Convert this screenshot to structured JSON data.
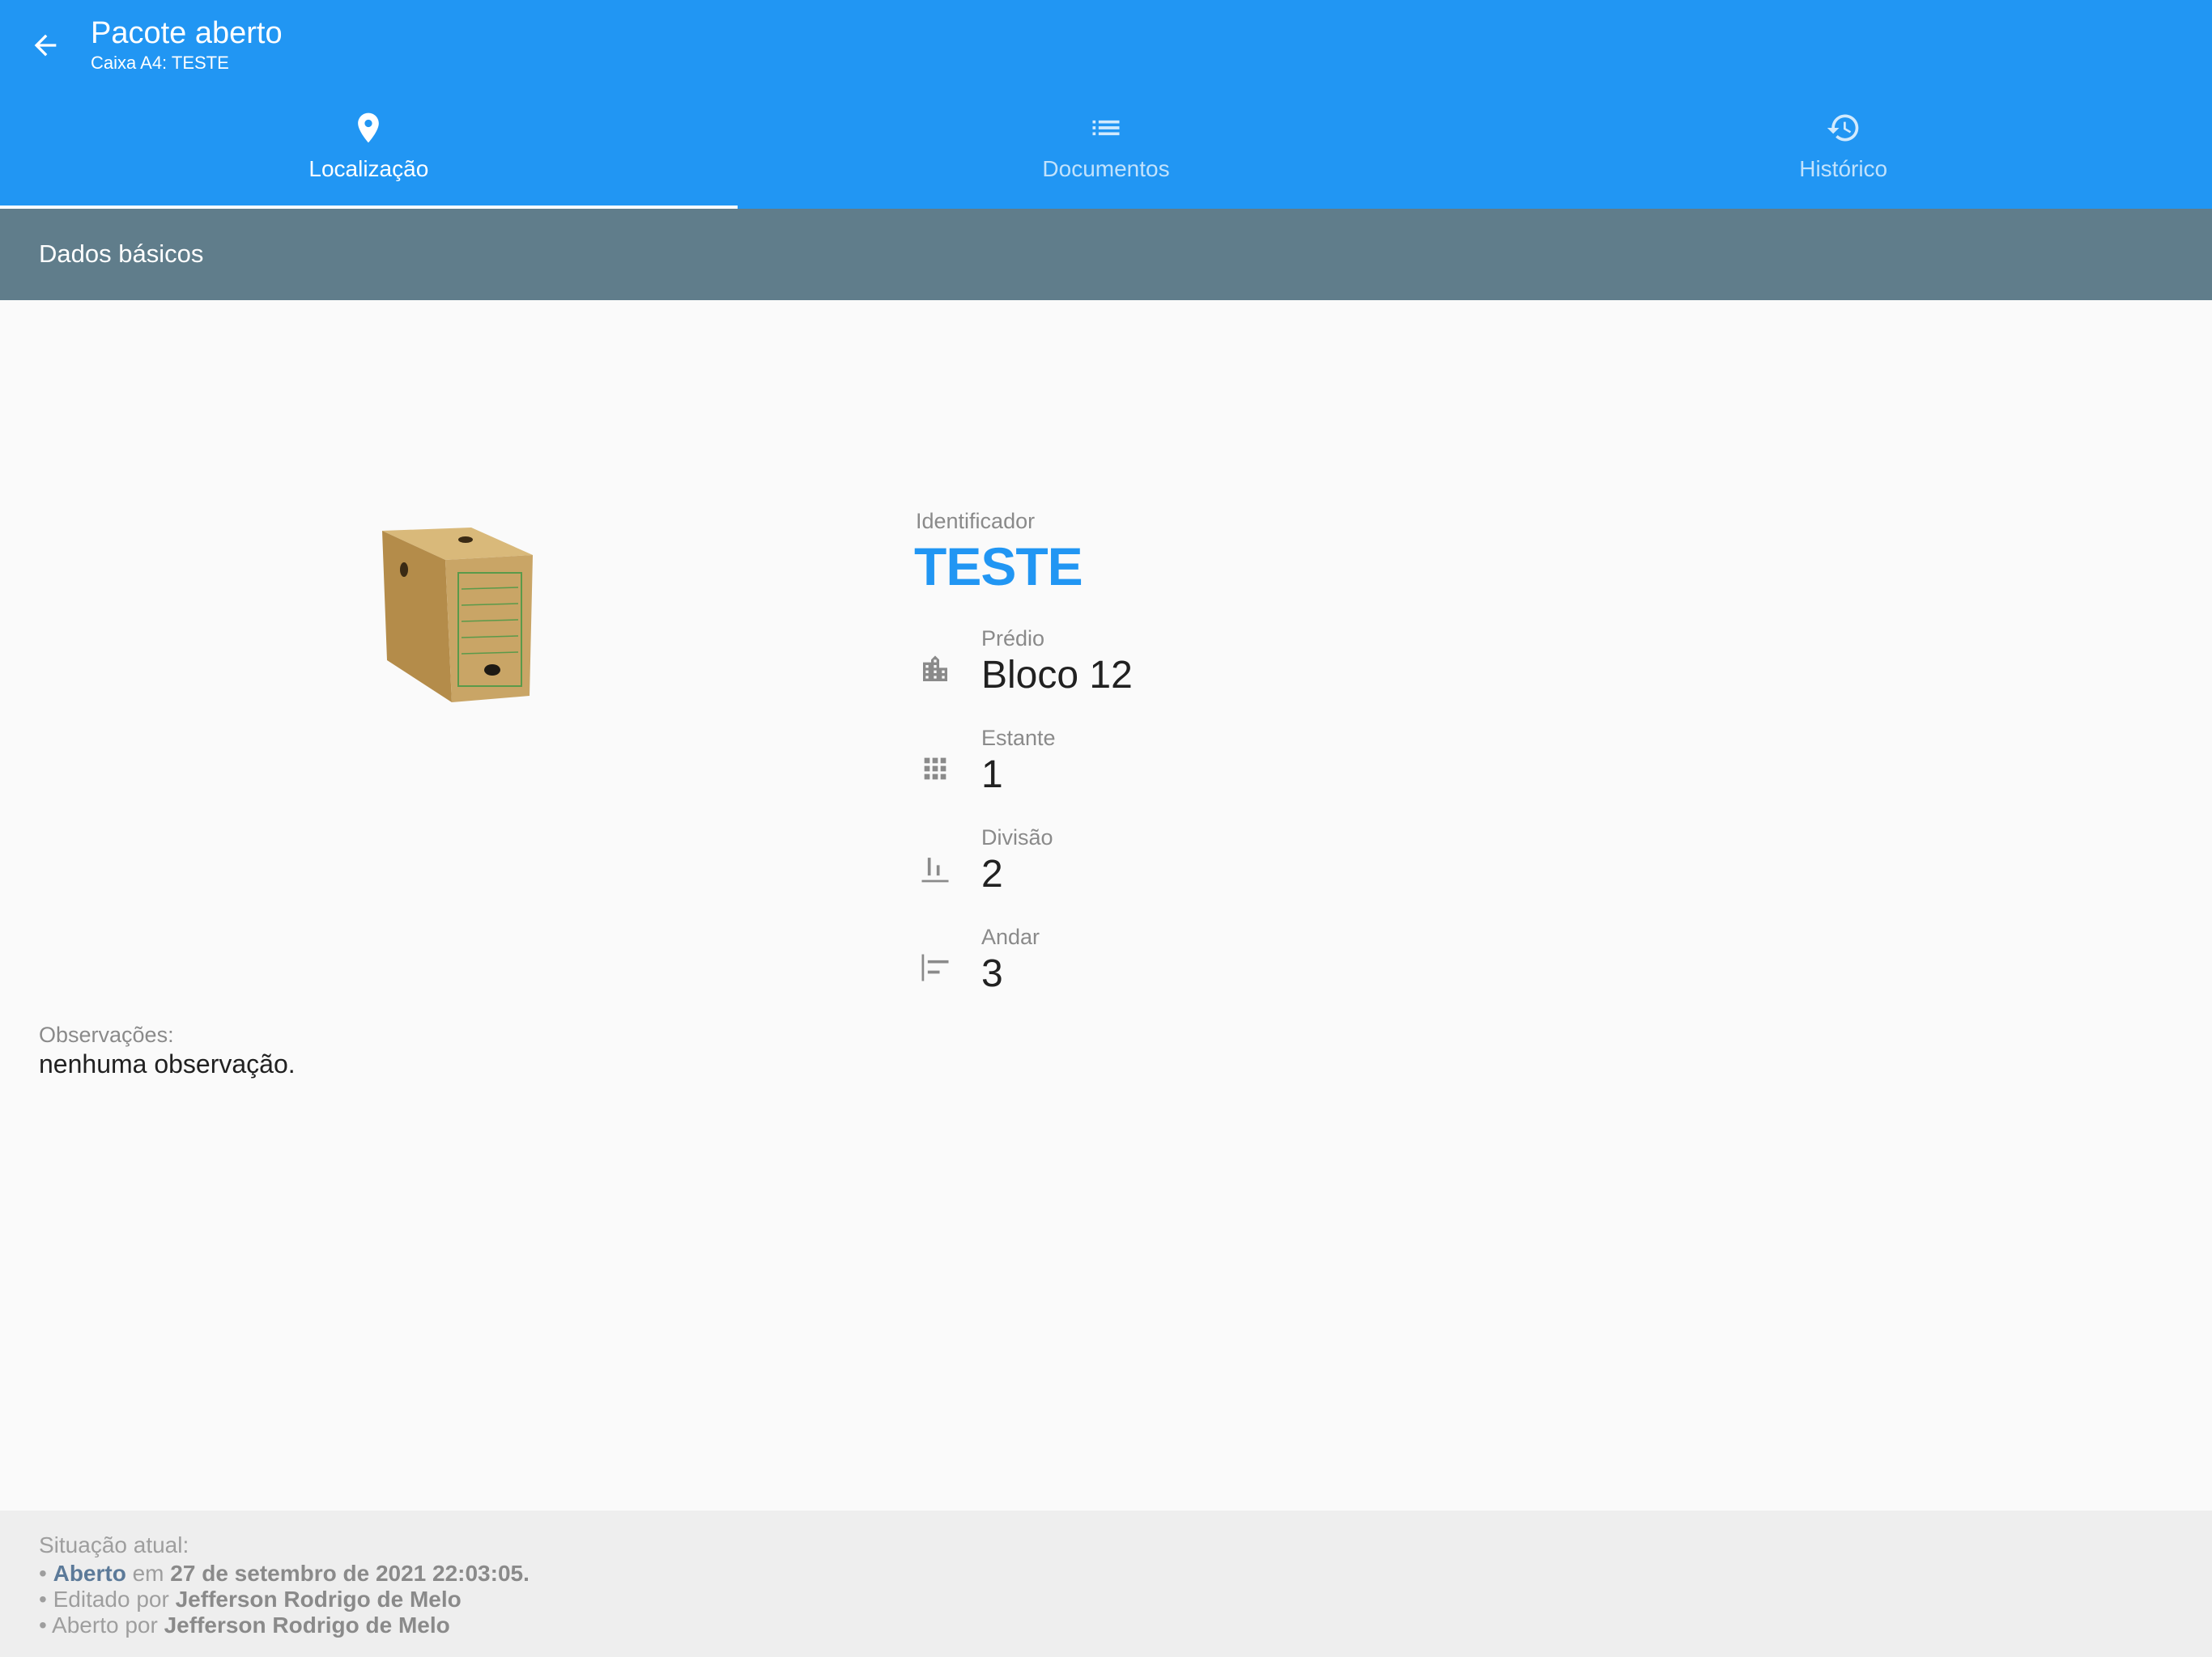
{
  "appbar": {
    "title": "Pacote aberto",
    "subtitle": "Caixa A4: TESTE",
    "back_icon": "arrow-back-icon"
  },
  "tabs": [
    {
      "label": "Localização",
      "icon": "location-pin-icon",
      "active": true
    },
    {
      "label": "Documentos",
      "icon": "list-icon",
      "active": false
    },
    {
      "label": "Histórico",
      "icon": "history-icon",
      "active": false
    }
  ],
  "section": {
    "title": "Dados básicos"
  },
  "identifier": {
    "label": "Identificador",
    "value": "TESTE"
  },
  "fields": [
    {
      "label": "Prédio",
      "value": "Bloco 12",
      "icon": "building-icon"
    },
    {
      "label": "Estante",
      "value": "1",
      "icon": "grid-icon"
    },
    {
      "label": "Divisão",
      "value": "2",
      "icon": "bar-chart-icon"
    },
    {
      "label": "Andar",
      "value": "3",
      "icon": "align-left-icon"
    }
  ],
  "observations": {
    "label": "Observações:",
    "value": "nenhuma observação."
  },
  "footer": {
    "situation_label": "Situação atual:",
    "bullet": "•",
    "status": "Aberto",
    "date_prefix": "em",
    "date": "27 de setembro de 2021 22:03:05.",
    "edited_prefix": "Editado por",
    "edited_by": "Jefferson Rodrigo de Melo",
    "opened_prefix": "Aberto por",
    "opened_by": "Jefferson Rodrigo de Melo"
  },
  "colors": {
    "primary": "#2196f3",
    "section": "#607d8b",
    "footer_bg": "#eeeeee"
  }
}
